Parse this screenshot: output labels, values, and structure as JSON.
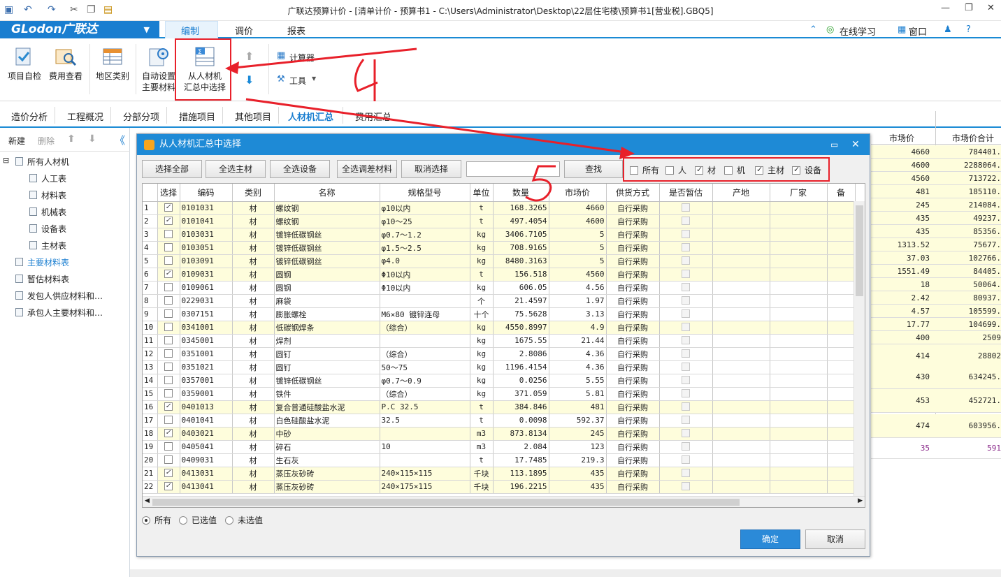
{
  "window": {
    "title": "广联达预算计价 - [清单计价 - 预算书1 - C:\\Users\\Administrator\\Desktop\\22层住宅楼\\预算书1[营业税].GBQ5]"
  },
  "menu": {
    "logo": "GLodon广联达",
    "tabs": [
      "编制",
      "调价",
      "报表"
    ],
    "active": "编制",
    "online": "在线学习",
    "window": "窗口"
  },
  "ribbon": {
    "project_check": "项目自检",
    "fee_view": "费用查看",
    "region": "地区类别",
    "auto_set_1": "自动设置",
    "auto_set_2": "主要材料",
    "select_1": "从人材机",
    "select_2": "汇总中选择",
    "calculator": "计算器",
    "tools": "工具"
  },
  "page_tabs": [
    "造价分析",
    "工程概况",
    "分部分项",
    "措施项目",
    "其他项目",
    "人材机汇总",
    "费用汇总"
  ],
  "left": {
    "new": "新建",
    "delete": "删除",
    "tree": [
      "所有人材机",
      "人工表",
      "材料表",
      "机械表",
      "设备表",
      "主材表",
      "主要材料表",
      "暂估材料表",
      "发包人供应材料和…",
      "承包人主要材料和…"
    ]
  },
  "bg": {
    "col1": "市场价",
    "col2": "市场价合计",
    "rows": [
      [
        "4660",
        "784401."
      ],
      [
        "4600",
        "2288064."
      ],
      [
        "4560",
        "713722."
      ],
      [
        "481",
        "185110."
      ],
      [
        "245",
        "214084."
      ],
      [
        "435",
        "49237."
      ],
      [
        "435",
        "85356."
      ],
      [
        "1313.52",
        "75677."
      ],
      [
        "37.03",
        "102766."
      ],
      [
        "1551.49",
        "84405."
      ],
      [
        "18",
        "50064."
      ],
      [
        "2.42",
        "80937."
      ],
      [
        "4.57",
        "105599."
      ],
      [
        "17.77",
        "104699."
      ],
      [
        "400",
        "2509"
      ],
      [
        "414",
        "28802"
      ],
      [
        "430",
        "634245."
      ],
      [
        "453",
        "452721."
      ],
      [
        "474",
        "603956."
      ],
      [
        "35",
        "591"
      ]
    ]
  },
  "dialog": {
    "title": "从人材机汇总中选择",
    "buttons": {
      "select_all": "选择全部",
      "all_main": "全选主材",
      "all_equipment": "全选设备",
      "all_adjust": "全选调差材料",
      "cancel_sel": "取消选择",
      "find": "查找"
    },
    "filters": [
      {
        "label": "所有",
        "checked": false
      },
      {
        "label": "人",
        "checked": false
      },
      {
        "label": "材",
        "checked": true
      },
      {
        "label": "机",
        "checked": false
      },
      {
        "label": "主材",
        "checked": true
      },
      {
        "label": "设备",
        "checked": true
      }
    ],
    "headers": [
      "选择",
      "编码",
      "类别",
      "名称",
      "规格型号",
      "单位",
      "数量",
      "市场价",
      "供货方式",
      "是否暂估",
      "产地",
      "厂家",
      "备"
    ],
    "rows": [
      [
        "1",
        true,
        "0101031",
        "材",
        "螺纹钢",
        "φ10以内",
        "t",
        "168.3265",
        "4660",
        "自行采购",
        true
      ],
      [
        "2",
        true,
        "0101041",
        "材",
        "螺纹钢",
        "φ10～25",
        "t",
        "497.4054",
        "4600",
        "自行采购",
        true
      ],
      [
        "3",
        false,
        "0103031",
        "材",
        "镀锌低碳钢丝",
        "φ0.7～1.2",
        "kg",
        "3406.7105",
        "5",
        "自行采购",
        true
      ],
      [
        "4",
        false,
        "0103051",
        "材",
        "镀锌低碳钢丝",
        "φ1.5～2.5",
        "kg",
        "708.9165",
        "5",
        "自行采购",
        true
      ],
      [
        "5",
        false,
        "0103091",
        "材",
        "镀锌低碳钢丝",
        "φ4.0",
        "kg",
        "8480.3163",
        "5",
        "自行采购",
        true
      ],
      [
        "6",
        true,
        "0109031",
        "材",
        "圆钢",
        "Φ10以内",
        "t",
        "156.518",
        "4560",
        "自行采购",
        true
      ],
      [
        "7",
        false,
        "0109061",
        "材",
        "圆钢",
        "Φ10以内",
        "kg",
        "606.05",
        "4.56",
        "自行采购",
        true
      ],
      [
        "8",
        false,
        "0229031",
        "材",
        "麻袋",
        "",
        "个",
        "21.4597",
        "1.97",
        "自行采购",
        false
      ],
      [
        "9",
        false,
        "0307151",
        "材",
        "膨胀螺栓",
        "M6×80 镀锌连母",
        "十个",
        "75.5628",
        "3.13",
        "自行采购",
        false
      ],
      [
        "10",
        false,
        "0341001",
        "材",
        "低碳钢焊条",
        "（综合）",
        "kg",
        "4550.8997",
        "4.9",
        "自行采购",
        true
      ],
      [
        "11",
        false,
        "0345001",
        "材",
        "焊剂",
        "",
        "kg",
        "1675.55",
        "21.44",
        "自行采购",
        false
      ],
      [
        "12",
        false,
        "0351001",
        "材",
        "圆钉",
        "（综合）",
        "kg",
        "2.8086",
        "4.36",
        "自行采购",
        false
      ],
      [
        "13",
        false,
        "0351021",
        "材",
        "圆钉",
        "50～75",
        "kg",
        "1196.4154",
        "4.36",
        "自行采购",
        false
      ],
      [
        "14",
        false,
        "0357001",
        "材",
        "镀锌低碳钢丝",
        "φ0.7～0.9",
        "kg",
        "0.0256",
        "5.55",
        "自行采购",
        false
      ],
      [
        "15",
        false,
        "0359001",
        "材",
        "铁件",
        "（综合）",
        "kg",
        "371.059",
        "5.81",
        "自行采购",
        false
      ],
      [
        "16",
        true,
        "0401013",
        "材",
        "复合普通硅酸盐水泥",
        "P.C 32.5",
        "t",
        "384.846",
        "481",
        "自行采购",
        true
      ],
      [
        "17",
        false,
        "0401041",
        "材",
        "白色硅酸盐水泥",
        "32.5",
        "t",
        "0.0098",
        "592.37",
        "自行采购",
        false
      ],
      [
        "18",
        true,
        "0403021",
        "材",
        "中砂",
        "",
        "m3",
        "873.8134",
        "245",
        "自行采购",
        true
      ],
      [
        "19",
        false,
        "0405041",
        "材",
        "碎石",
        "10",
        "m3",
        "2.084",
        "123",
        "自行采购",
        true
      ],
      [
        "20",
        false,
        "0409031",
        "材",
        "生石灰",
        "",
        "t",
        "17.7485",
        "219.3",
        "自行采购",
        false
      ],
      [
        "21",
        true,
        "0413031",
        "材",
        "蒸压灰砂砖",
        "240×115×115",
        "千块",
        "113.1895",
        "435",
        "自行采购",
        true
      ],
      [
        "22",
        true,
        "0413041",
        "材",
        "蒸压灰砂砖",
        "240×175×115",
        "千块",
        "196.2215",
        "435",
        "自行采购",
        true
      ]
    ],
    "radios": [
      {
        "label": "所有",
        "on": true
      },
      {
        "label": "已选值",
        "on": false
      },
      {
        "label": "未选值",
        "on": false
      }
    ],
    "ok": "确定",
    "cancel": "取消"
  },
  "annotations": {
    "arrow_color": "#e8202a"
  }
}
